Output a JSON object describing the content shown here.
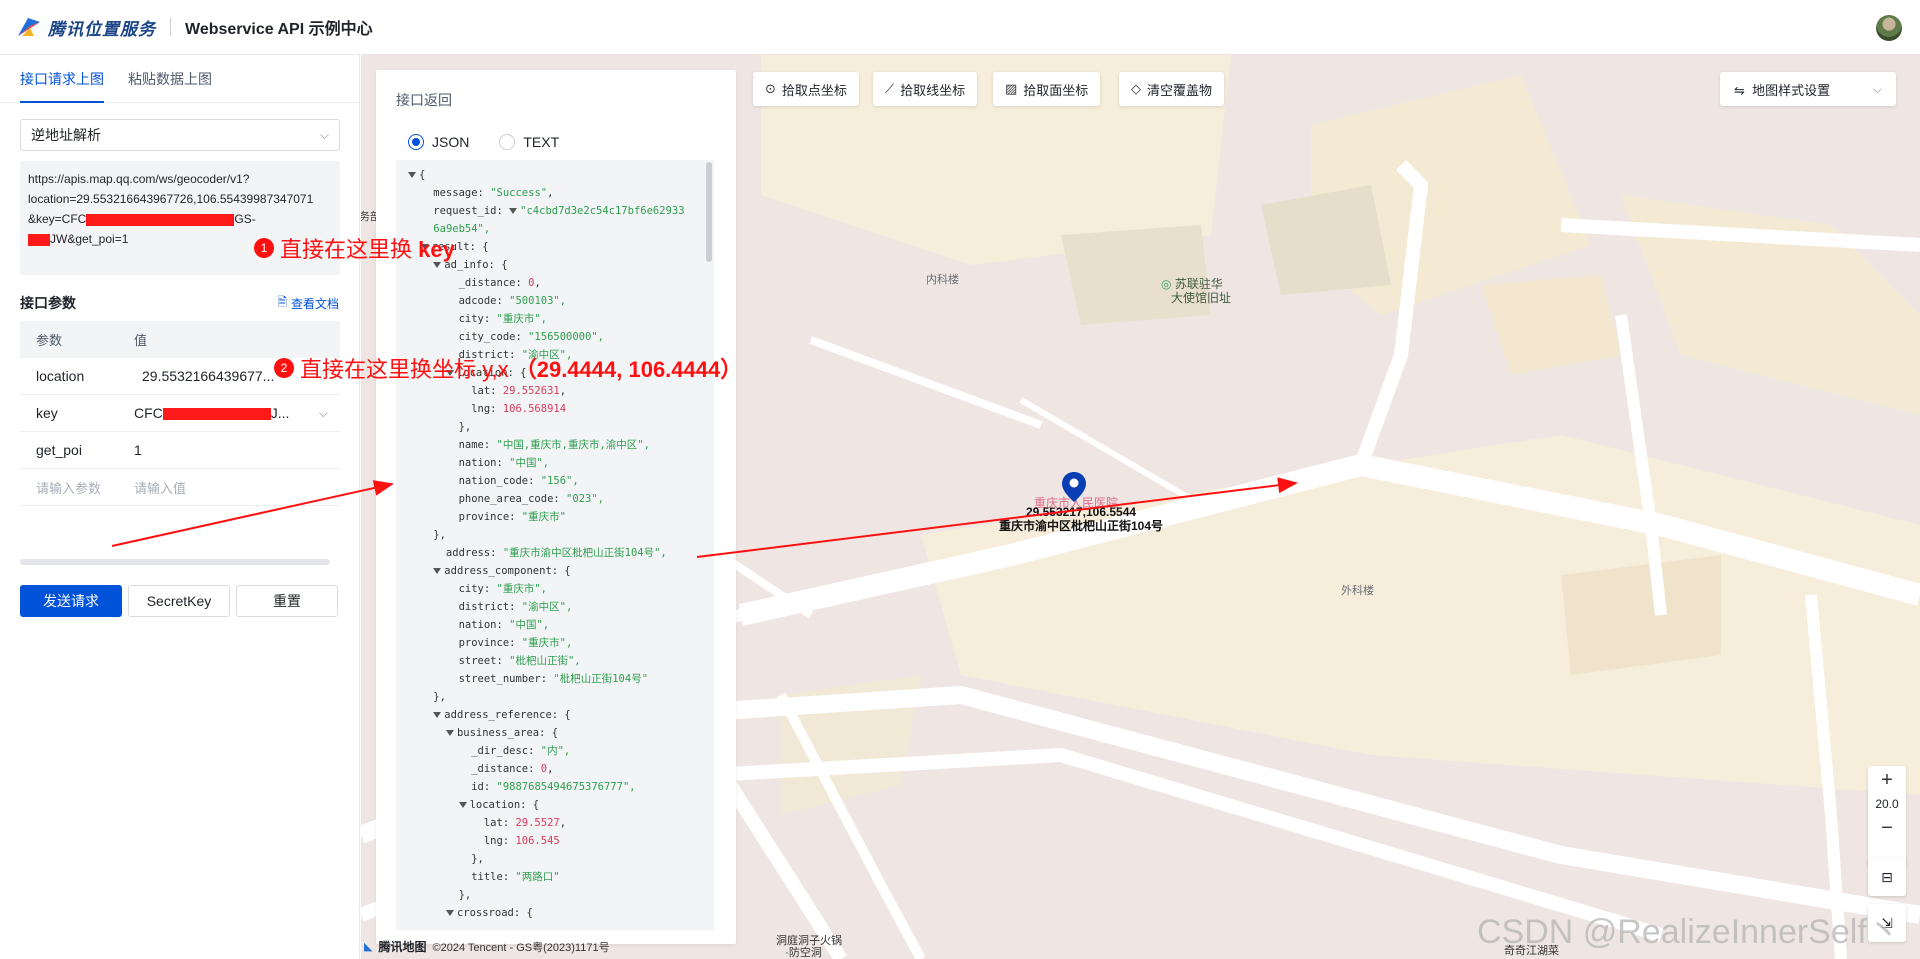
{
  "header": {
    "brand": "腾讯位置服务",
    "title": "Webservice API 示例中心"
  },
  "left": {
    "tabs": [
      "接口请求上图",
      "粘贴数据上图"
    ],
    "api_select": "逆地址解析",
    "url_line1": "https://apis.map.qq.com/ws/geocoder/v1?",
    "url_line2": "location=29.553216643967726,106.55439987347071",
    "url_line3a": "&key=CFC",
    "url_line3b": "GS-",
    "url_line4": "JW&get_poi=1",
    "params_title": "接口参数",
    "doc_link": "查看文档",
    "col_param": "参数",
    "col_value": "值",
    "rows": [
      {
        "name": "location",
        "value": "29.5532166439677..."
      },
      {
        "name": "key",
        "value_prefix": "CFC",
        "value_suffix": "J..."
      },
      {
        "name": "get_poi",
        "value": "1"
      }
    ],
    "placeholder_param": "请输入参数",
    "placeholder_value": "请输入值",
    "btn_send": "发送请求",
    "btn_secret": "SecretKey",
    "btn_reset": "重置"
  },
  "response": {
    "title": "接口返回",
    "radio_json": "JSON",
    "radio_text": "TEXT",
    "json": {
      "message": "\"Success\"",
      "request_id_1": "\"c4cbd7d3e2c54c17bf6e62933",
      "request_id_2": "6a9eb54\",",
      "distance": "0",
      "adcode": "\"500103\",",
      "city": "\"重庆市\",",
      "city_code": "\"156500000\",",
      "district": "\"渝中区\",",
      "lat": "29.552631",
      "lng": "106.568914",
      "name": "\"中国,重庆市,重庆市,渝中区\",",
      "nation": "\"中国\",",
      "nation_code": "\"156\",",
      "phone_area_code": "\"023\",",
      "province": "\"重庆市\"",
      "address": "\"重庆市渝中区枇杷山正街104号\",",
      "ac_city": "\"重庆市\",",
      "ac_district": "\"渝中区\",",
      "ac_nation": "\"中国\",",
      "ac_province": "\"重庆市\",",
      "ac_street": "\"枇杷山正街\",",
      "ac_street_number": "\"枇杷山正街104号\"",
      "dir_desc": "\"内\",",
      "ba_distance": "0",
      "ba_id": "\"9887685494675376777\",",
      "ba_lat": "29.5527",
      "ba_lng": "106.545",
      "ba_title": "\"两路口\""
    }
  },
  "map": {
    "tools": [
      "拾取点坐标",
      "拾取线坐标",
      "拾取面坐标",
      "清空覆盖物"
    ],
    "style_btn": "地图样式设置",
    "zoom_in": "+",
    "zoom_level": "20.0",
    "zoom_out": "−",
    "label_neike": "内科楼",
    "label_waike": "外科楼",
    "poi_1": "苏联驻华",
    "poi_2": "大使馆旧址",
    "pin_name": "重庆市人民医院",
    "pin_coord": "29.553217,106.5544",
    "pin_address": "重庆市渝中区枇杷山正街104号",
    "bottom_poi_1": "洞庭洞子火锅",
    "bottom_poi_2": "·防空洞",
    "bottom_poi_3": "奇奇江湖菜",
    "edge_label": "务部",
    "footer_brand": "腾讯地图",
    "footer_copy": "©2024 Tencent - GS粤(2023)1171号",
    "watermark": "CSDN @RealizeInnerSelf丶"
  },
  "annotations": {
    "num1": "1",
    "text1_a": "直接在这里换 ",
    "text1_b": "key",
    "num2": "2",
    "text2_a": "直接在这里换坐标 y,x ",
    "text2_b": "（29.4444, 106.4444）"
  },
  "colors": {
    "primary": "#0052d9",
    "annotation": "#ff1010",
    "map_bg": "#f1e6e4",
    "building": "#f5ecd6",
    "road": "#ffffff"
  }
}
